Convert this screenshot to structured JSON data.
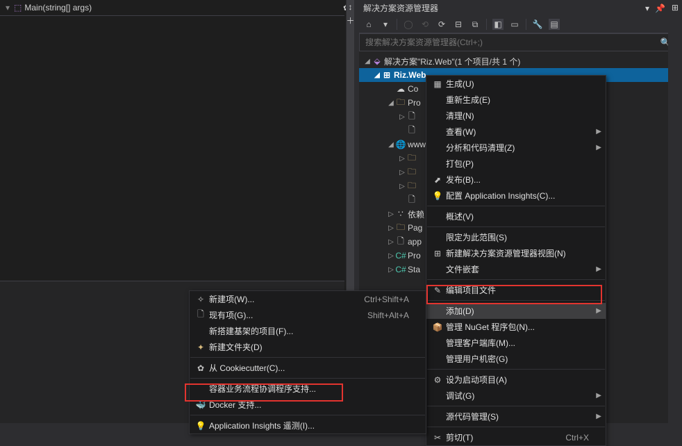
{
  "editor": {
    "method": "Main(string[] args)"
  },
  "panel": {
    "title": "解决方案资源管理器",
    "search_placeholder": "搜索解决方案资源管理器(Ctrl+;)",
    "solution_line": "解决方案\"Riz.Web\"(1 个项目/共 1 个)",
    "project": "Riz.Web",
    "nodes": {
      "connected": "Co",
      "properties": "Pro",
      "wwwroot": "www",
      "deps": "依赖",
      "pages": "Pag",
      "app": "app",
      "prog": "Pro",
      "startup": "Sta"
    }
  },
  "ctx1": {
    "build": "生成(U)",
    "rebuild": "重新生成(E)",
    "clean": "清理(N)",
    "view": "查看(W)",
    "analyze": "分析和代码清理(Z)",
    "pack": "打包(P)",
    "publish": "发布(B)...",
    "insights": "配置 Application Insights(C)...",
    "overview": "概述(V)",
    "scope": "限定为此范围(S)",
    "newview": "新建解决方案资源管理器视图(N)",
    "nest": "文件嵌套",
    "editproj": "编辑项目文件",
    "add": "添加(D)",
    "nuget": "管理 NuGet 程序包(N)...",
    "clientlib": "管理客户端库(M)...",
    "secrets": "管理用户机密(G)",
    "startup": "设为启动项目(A)",
    "debug": "调试(G)",
    "scm": "源代码管理(S)",
    "cut": "剪切(T)",
    "cut_short": "Ctrl+X"
  },
  "ctx2": {
    "newitem": "新建项(W)...",
    "newitem_short": "Ctrl+Shift+A",
    "existing": "现有项(G)...",
    "existing_short": "Shift+Alt+A",
    "scaffold": "新搭建基架的项目(F)...",
    "newfolder": "新建文件夹(D)",
    "cookie": "从 Cookiecutter(C)...",
    "container": "容器业务流程协调程序支持...",
    "docker": "Docker 支持...",
    "telemetry": "Application Insights 遥测(I)..."
  }
}
